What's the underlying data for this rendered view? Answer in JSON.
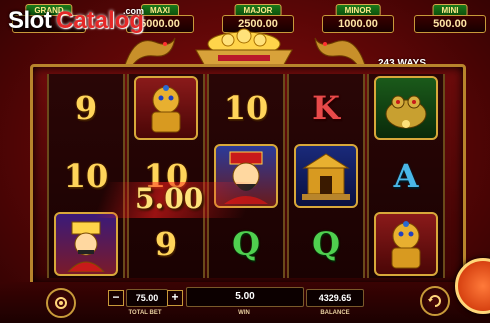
{
  "jackpots": [
    {
      "label": "GRAND",
      "value": ""
    },
    {
      "label": "MAXI",
      "value": "5000.00"
    },
    {
      "label": "MAJOR",
      "value": "2500.00"
    },
    {
      "label": "MINOR",
      "value": "1000.00"
    },
    {
      "label": "MINI",
      "value": "500.00"
    }
  ],
  "watermark": {
    "slot": "Slot",
    "catalog": "Catalog",
    "com": ".com"
  },
  "ways": "243 WAYS",
  "reels": [
    [
      "9",
      "10",
      "cai-shen-red"
    ],
    [
      "lion-gold",
      "10",
      "9"
    ],
    [
      "10",
      "cai-shen-face",
      "Q"
    ],
    [
      "K",
      "temple-gold",
      "Q"
    ],
    [
      "toad-gold",
      "A",
      "lion-gold"
    ]
  ],
  "win_float": "5.00",
  "bottom": {
    "total_bet_value": "75.00",
    "total_bet_label": "TOTAL BET",
    "minus": "−",
    "plus": "+",
    "win_value": "5.00",
    "win_label": "WIN",
    "balance_value": "4329.65",
    "balance_label": "BALANCE"
  },
  "colors": {
    "gold": "#ffd45a",
    "red_bg": "#5a0606",
    "q_green": "#4fd04f",
    "k_red": "#e84a4a",
    "a_blue": "#4ab7e8"
  }
}
